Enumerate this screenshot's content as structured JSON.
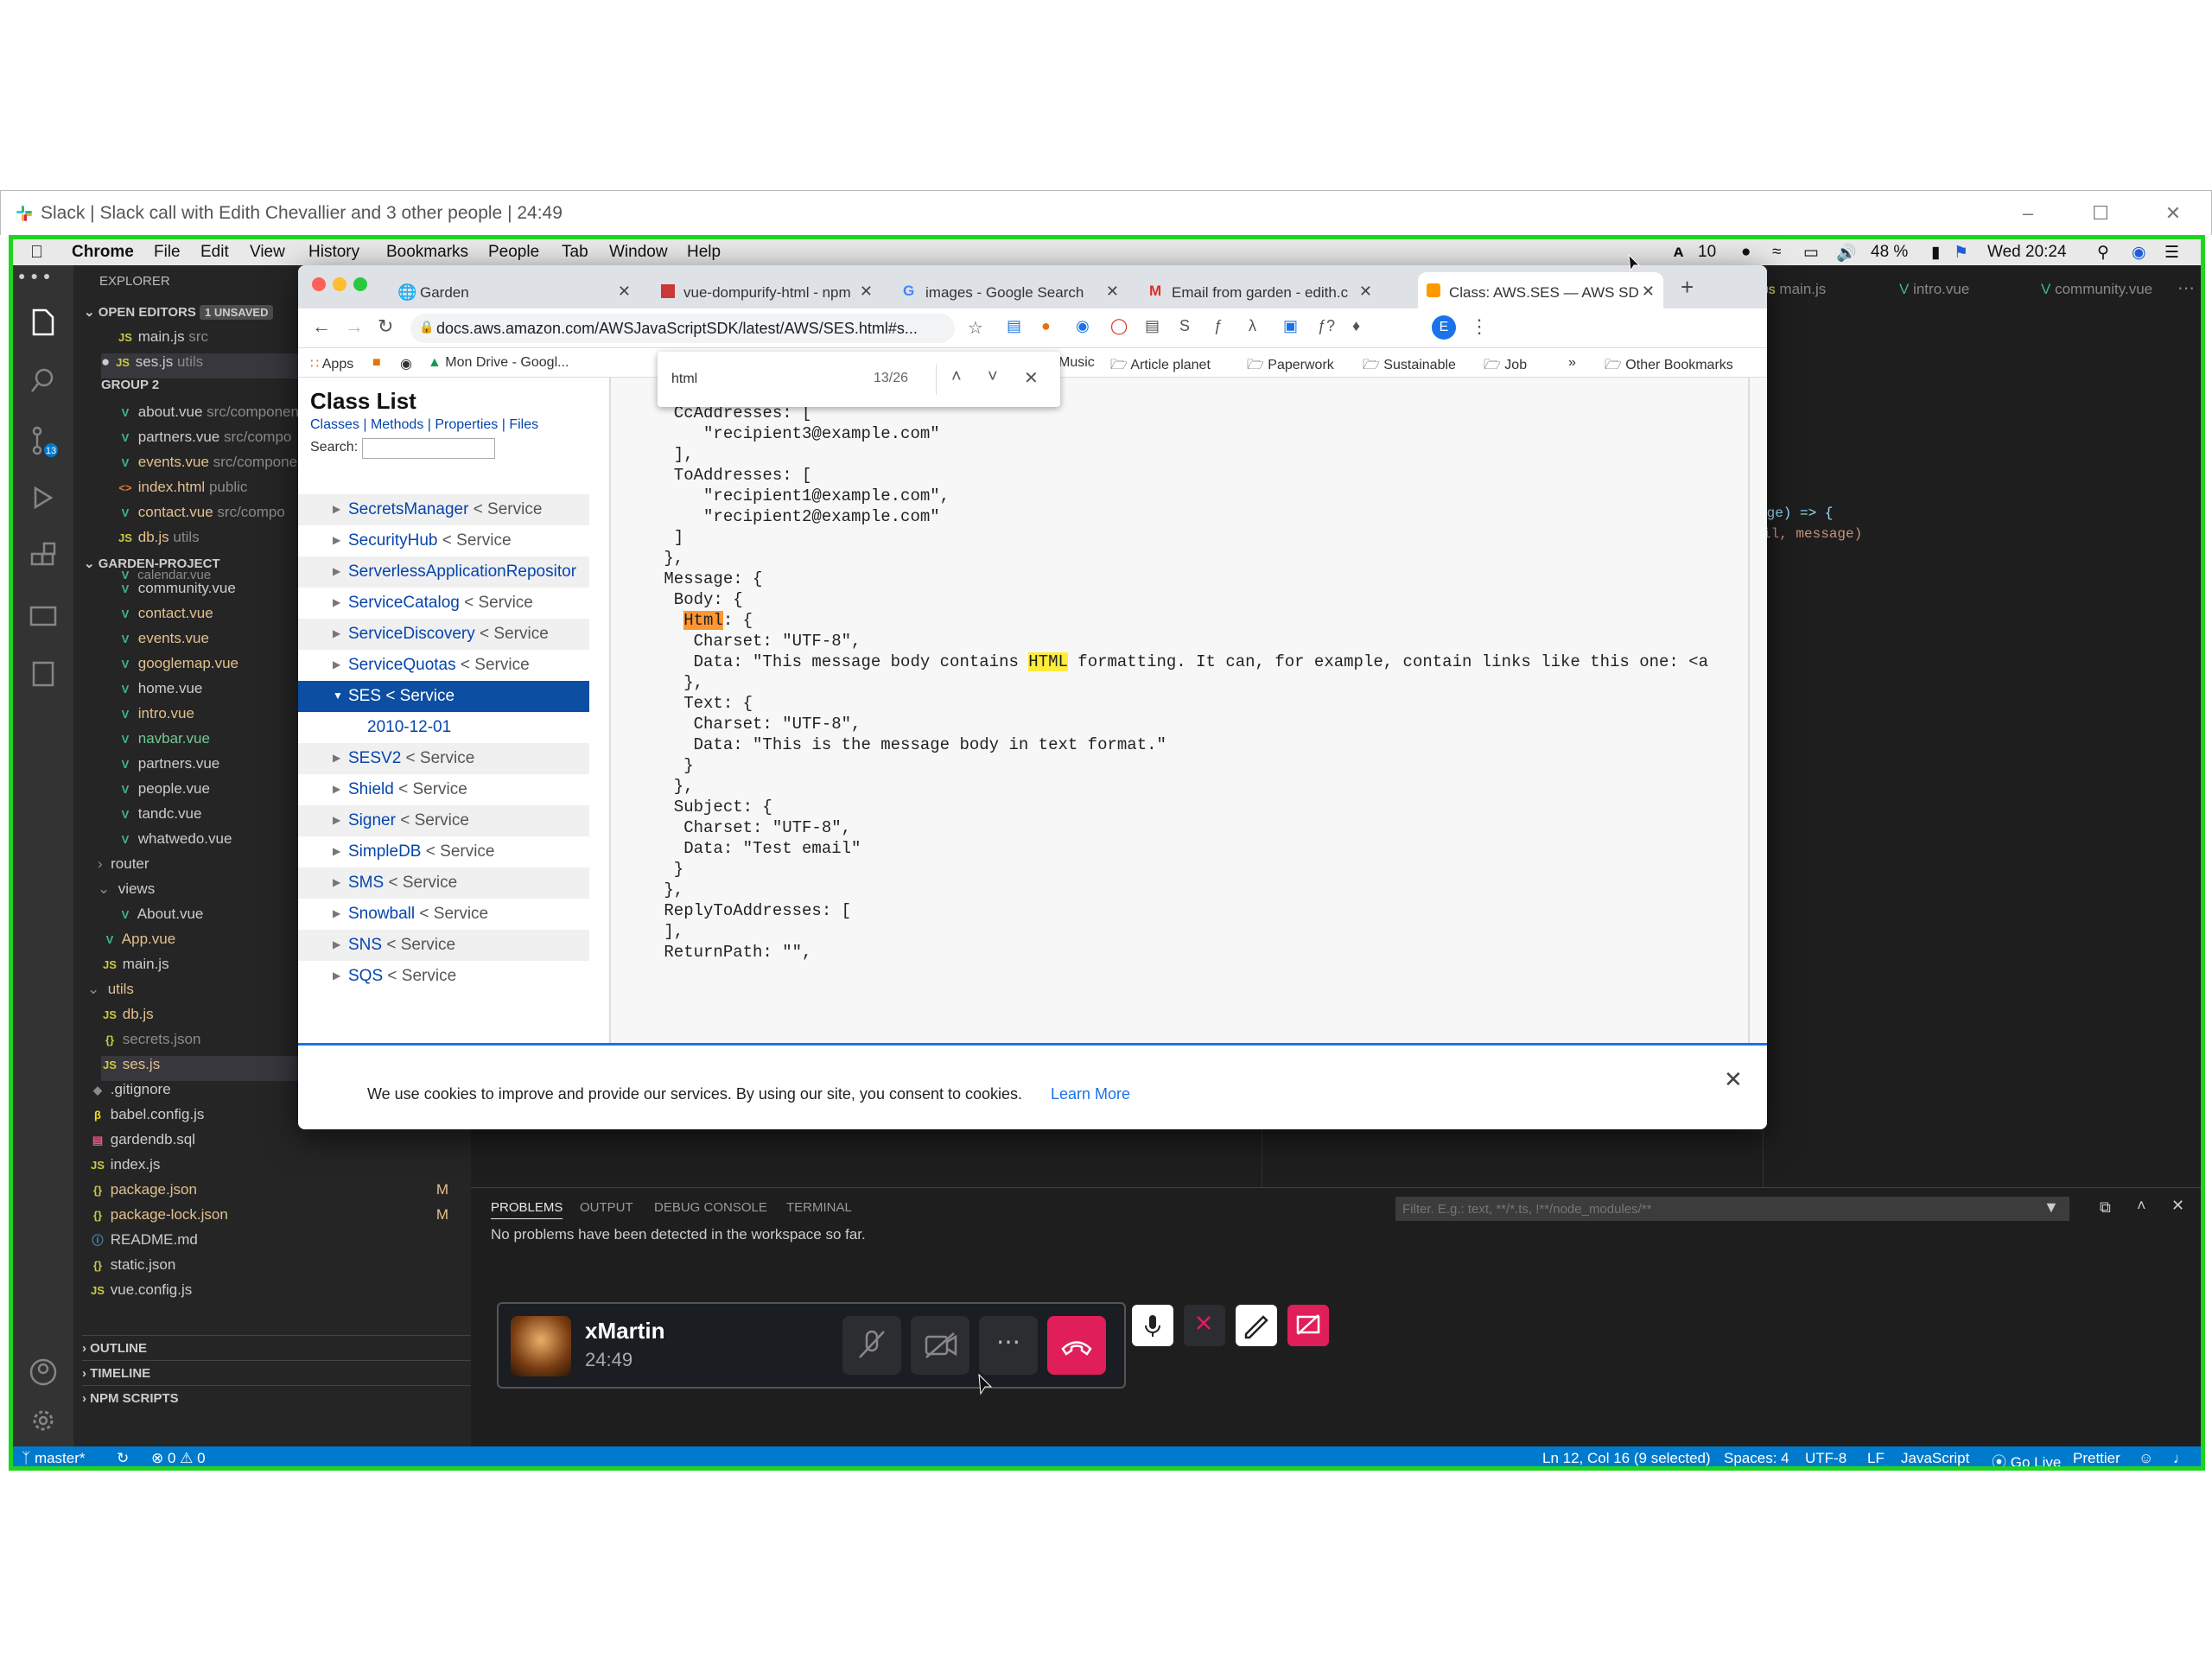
{
  "slack": {
    "title": "Slack | Slack call with Edith Chevallier and 3 other people | 24:49"
  },
  "menubar": {
    "items": [
      "Chrome",
      "File",
      "Edit",
      "View",
      "History",
      "Bookmarks",
      "People",
      "Tab",
      "Window",
      "Help"
    ],
    "right": {
      "adobe": "10",
      "battery": "48 %",
      "clock": "Wed 20:24"
    }
  },
  "sidebar": {
    "explorer": "EXPLORER",
    "open_editors": "OPEN EDITORS",
    "unsaved": "1 UNSAVED",
    "open_files": [
      {
        "name": "main.js",
        "path": "src",
        "type": "js"
      },
      {
        "name": "ses.js",
        "path": "utils",
        "type": "js"
      }
    ],
    "group2": "GROUP 2",
    "group2_files": [
      {
        "name": "about.vue",
        "path": "src/componen"
      },
      {
        "name": "partners.vue",
        "path": "src/compo"
      },
      {
        "name": "events.vue",
        "path": "src/compone"
      },
      {
        "name": "index.html",
        "path": "public"
      },
      {
        "name": "contact.vue",
        "path": "src/compo"
      },
      {
        "name": "db.js",
        "path": "utils"
      }
    ],
    "project": "GARDEN-PROJECT",
    "project_files": [
      "calendar.vue",
      "community.vue",
      "contact.vue",
      "events.vue",
      "googlemap.vue",
      "home.vue",
      "intro.vue",
      "navbar.vue",
      "partners.vue",
      "people.vue",
      "tandc.vue",
      "whatwedo.vue"
    ],
    "router": "router",
    "views": "views",
    "about": "About.vue",
    "app": "App.vue",
    "mainjs": "main.js",
    "utils": "utils",
    "dbjs": "db.js",
    "secrets": "secrets.json",
    "sesjs": "ses.js",
    "root_files": [
      ".gitignore",
      "babel.config.js",
      "gardendb.sql",
      "index.js",
      "package.json",
      "package-lock.json",
      "README.md",
      "static.json",
      "vue.config.js"
    ],
    "modified": "M",
    "outline": "OUTLINE",
    "timeline": "TIMELINE",
    "npm": "NPM SCRIPTS"
  },
  "editor_tabs": [
    "main.js",
    "intro.vue",
    "community.vue"
  ],
  "editor_snippets": {
    "a": "age) => {",
    "b": "il, message)"
  },
  "chrome": {
    "tabs": [
      "Garden",
      "vue-dompurify-html - npm",
      "images - Google Search",
      "Email from garden - edith.c",
      "Class: AWS.SES — AWS SD"
    ],
    "url": "docs.aws.amazon.com/AWSJavaScriptSDK/latest/AWS/SES.html#s...",
    "bookmarks": [
      "Apps",
      "Mon Drive - Googl...",
      "Music",
      "Article planet",
      "Paperwork",
      "Sustainable",
      "Job",
      "»",
      "Other Bookmarks"
    ],
    "find": {
      "query": "html",
      "count": "13/26"
    },
    "profile": "E"
  },
  "classlist": {
    "title": "Class List",
    "links": [
      "Classes",
      "Methods",
      "Properties",
      "Files"
    ],
    "search_label": "Search:",
    "items": [
      {
        "name": "SecretsManager",
        "svc": "< Service"
      },
      {
        "name": "SecurityHub",
        "svc": "< Service"
      },
      {
        "name": "ServerlessApplicationRepositor",
        "svc": ""
      },
      {
        "name": "ServiceCatalog",
        "svc": "< Service"
      },
      {
        "name": "ServiceDiscovery",
        "svc": "< Service"
      },
      {
        "name": "ServiceQuotas",
        "svc": "< Service"
      },
      {
        "name": "SES",
        "svc": "< Service"
      },
      {
        "name": "2010-12-01",
        "svc": ""
      },
      {
        "name": "SESV2",
        "svc": "< Service"
      },
      {
        "name": "Shield",
        "svc": "< Service"
      },
      {
        "name": "Signer",
        "svc": "< Service"
      },
      {
        "name": "SimpleDB",
        "svc": "< Service"
      },
      {
        "name": "SMS",
        "svc": "< Service"
      },
      {
        "name": "Snowball",
        "svc": "< Service"
      },
      {
        "name": "SNS",
        "svc": "< Service"
      },
      {
        "name": "SQS",
        "svc": "< Service"
      }
    ]
  },
  "code": {
    "lines": [
      "  ],",
      "  CcAddresses: [",
      "     \"recipient3@example.com\"",
      "  ],",
      "  ToAddresses: [",
      "     \"recipient1@example.com\",",
      "     \"recipient2@example.com\"",
      "  ]",
      " },",
      " Message: {",
      "  Body: {",
      "   Html: {",
      "    Charset: \"UTF-8\",",
      "    Data: \"This message body contains HTML formatting. It can, for example, contain links like this one: <a",
      "   },",
      "   Text: {",
      "    Charset: \"UTF-8\",",
      "    Data: \"This is the message body in text format.\"",
      "   }",
      "  },",
      "  Subject: {",
      "   Charset: \"UTF-8\",",
      "   Data: \"Test email\"",
      "  }",
      " },",
      " ReplyToAddresses: [",
      " ],",
      " ReturnPath: \"\","
    ]
  },
  "cookie": {
    "text": "We use cookies to improve and provide our services. By using our site, you consent to cookies.",
    "link": "Learn More"
  },
  "panel": {
    "tabs": [
      "PROBLEMS",
      "OUTPUT",
      "DEBUG CONSOLE",
      "TERMINAL"
    ],
    "message": "No problems have been detected in the workspace so far.",
    "filter_placeholder": "Filter. E.g.: text, **/*.ts, !**/node_modules/**"
  },
  "call": {
    "name": "xMartin",
    "time": "24:49"
  },
  "status": {
    "branch": "master*",
    "errors": "0",
    "warnings": "0",
    "position": "Ln 12, Col 16 (9 selected)",
    "spaces": "Spaces: 4",
    "encoding": "UTF-8",
    "eol": "LF",
    "language": "JavaScript",
    "golive": "Go Live",
    "prettier": "Prettier"
  },
  "colors": {
    "share_border": "#1fd41f",
    "vscode_blue": "#007acc",
    "hangup": "#e01e5a"
  }
}
